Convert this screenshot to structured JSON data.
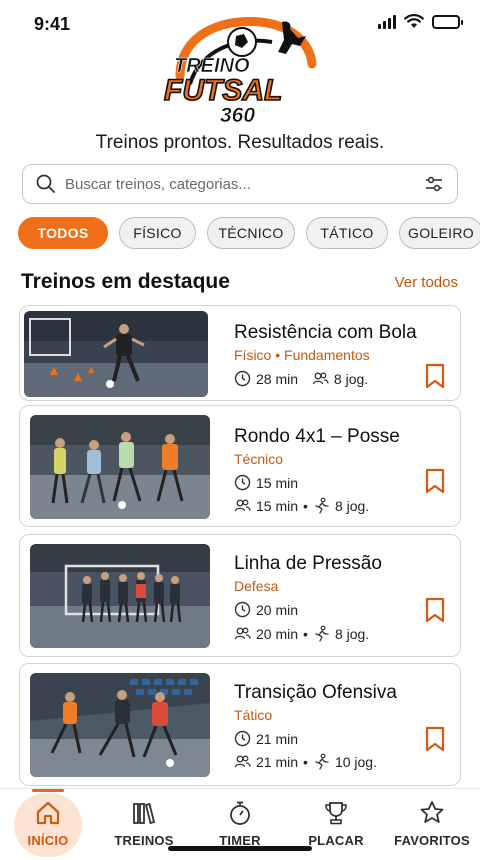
{
  "status_bar": {
    "time": "9:41"
  },
  "logo": {
    "line1": "TREINO",
    "line2": "FUTSAL",
    "line3": "360"
  },
  "tagline": "Treinos prontos. Resultados reais.",
  "search": {
    "placeholder": "Buscar treinos, categorias..."
  },
  "filters": [
    "TODOS",
    "FÍSICO",
    "TÉCNICO",
    "TÁTICO",
    "GOLEIRO"
  ],
  "section": {
    "title": "Treinos em destaque",
    "see_all": "Ver todos"
  },
  "cards": [
    {
      "title": "Resistência com Bola",
      "category": "Físico • Fundamentos",
      "duration": "28 min",
      "players": "8 jog.",
      "time_line2": ""
    },
    {
      "title": "Rondo 4x1 – Posse",
      "category": "Técnico",
      "duration": "15 min",
      "players": "8 jog.",
      "time_line2": "15 min"
    },
    {
      "title": "Linha de Pressão",
      "category": "Defesa",
      "duration": "20 min",
      "players": "8 jog.",
      "time_line2": "20 min"
    },
    {
      "title": "Transição Ofensiva",
      "category": "Tático",
      "duration": "21 min",
      "players": "10 jog.",
      "time_line2": "21 min"
    }
  ],
  "nav": [
    {
      "label": "INÍCIO",
      "icon": "home-icon"
    },
    {
      "label": "TREINOS",
      "icon": "books-icon"
    },
    {
      "label": "TIMER",
      "icon": "stopwatch-icon"
    },
    {
      "label": "PLACAR",
      "icon": "trophy-icon"
    },
    {
      "label": "FAVORITOS",
      "icon": "star-icon"
    }
  ],
  "colors": {
    "accent": "#f07019",
    "accent_text": "#c45a10"
  }
}
